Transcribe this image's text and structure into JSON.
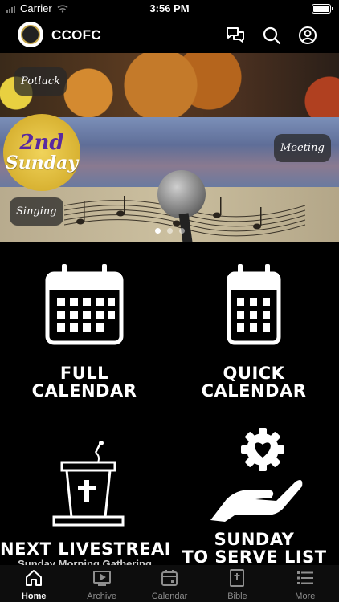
{
  "status_bar": {
    "carrier": "Carrier",
    "time": "3:56 PM"
  },
  "header": {
    "title": "CCOFC",
    "icons": [
      "chat-icon",
      "search-icon",
      "profile-icon"
    ]
  },
  "banner": {
    "slides": [
      {
        "label": "Potluck"
      },
      {
        "badge_line1": "2nd",
        "badge_line2": "Sunday",
        "label": "Meeting"
      },
      {
        "label": "Singing"
      }
    ],
    "active_dot": 0,
    "dot_count": 3
  },
  "tiles": {
    "full_calendar": {
      "line1": "FULL",
      "line2": "CALENDAR"
    },
    "quick_calendar": {
      "line1": "QUICK",
      "line2": "CALENDAR"
    },
    "next_livestream": {
      "line1": "NEXT LIVESTREAM",
      "sub": "Sunday Morning Gathering"
    },
    "sunday_serve": {
      "line1": "SUNDAY",
      "line2": "TO SERVE LIST"
    }
  },
  "tab_bar": {
    "items": [
      {
        "label": "Home",
        "icon": "home-icon",
        "active": true
      },
      {
        "label": "Archive",
        "icon": "play-icon",
        "active": false
      },
      {
        "label": "Calendar",
        "icon": "calendar-icon",
        "active": false
      },
      {
        "label": "Bible",
        "icon": "bible-icon",
        "active": false
      },
      {
        "label": "More",
        "icon": "menu-icon",
        "active": false
      }
    ]
  },
  "colors": {
    "background": "#000000",
    "foreground": "#ffffff",
    "tab_inactive": "#8e8e8e"
  }
}
